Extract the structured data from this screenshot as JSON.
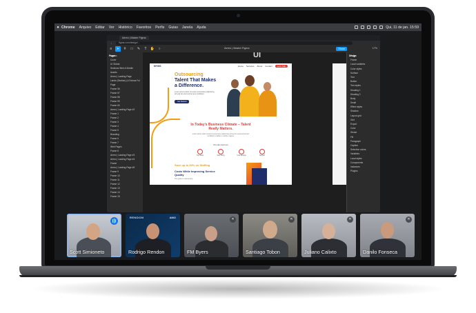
{
  "menubar": {
    "apple": "",
    "app": "Chrome",
    "items": [
      "Arquivo",
      "Editar",
      "Ver",
      "Histórico",
      "Favoritos",
      "Perfis",
      "Guias",
      "Janela",
      "Ajuda"
    ],
    "clock": "Qui, 11 de jan.  15:59"
  },
  "browser": {
    "tab": "Aereo | Master Figma",
    "url": "figma.com/design/..."
  },
  "figma": {
    "file_name": "Aereo | Master Figma",
    "share_label": "Share",
    "zoom": "17%",
    "canvas_heading": "UI",
    "layers_header": "Pages",
    "layers": [
      "Layers",
      "Cover",
      "UI Global",
      "Sections Web & Mobile",
      "Assets",
      "Aereo | Landing Page",
      "Lands (Section) (UI Novas Fol",
      "Page",
      "Frame 56",
      "Frame 57",
      "Frame 58",
      "Frame 59",
      "Frame 60",
      "Aereo | Landing Page #2",
      "Frame 1",
      "Frame 2",
      "Frame 3",
      "Frame 4",
      "Frame 5",
      "Branding",
      "Frame 6",
      "Frame 7",
      "Web Pages",
      "Frame 8",
      "Aereo | Landing Page #3",
      "Aereo | Landing Page #4",
      "Frame",
      "Aereo | Landing Page #5",
      "Frame 9",
      "Frame 10",
      "Frame 11",
      "Frame 12",
      "Frame 13",
      "Frame 14",
      "Frame 15"
    ],
    "props_header": "Design",
    "props": [
      "Page",
      "Frame",
      "Local variables",
      "Color styles",
      "Surface",
      "Text",
      "Button",
      "Text styles",
      "Heading 1",
      "Heading 2",
      "Body",
      "Small",
      "Effect styles",
      "Shadow",
      "Layout grid",
      "Grid",
      "Export",
      "Color",
      "Stroke",
      "Fill",
      "Paragraph",
      "Caption",
      "Selection colors",
      "Variables",
      "Local styles",
      "Components",
      "Instances",
      "Plugins"
    ]
  },
  "webpage": {
    "logo": "MYSIS",
    "nav_links": [
      "Home",
      "Services",
      "About",
      "Contact"
    ],
    "nav_cta": "Let's Talk",
    "hero_line1": "Outsourcing",
    "hero_line2": "Talent That Makes",
    "hero_line3": "a Difference.",
    "hero_sub": "Lorem ipsum dolor sit amet consectetur adipiscing elit sed do eiusmod tempor incididunt.",
    "hero_button": "Get Started",
    "sec2_title1": "In Today's Business Climate – Talent",
    "sec2_title2": "Really Matters.",
    "sec2_body": "Lorem ipsum dolor sit amet consectetur adipiscing elit sed do eiusmod tempor incididunt ut labore et dolore magna.",
    "sec2_heading": "You can count on:",
    "features": [
      "Top talent",
      "Fast hiring",
      "Cost savings",
      "Support"
    ],
    "sec3_line1": "Save up to 50% on Staffing",
    "sec3_line2": "Costs While Improving Service Quality",
    "sec3_sub": "The guide to outsourcing"
  },
  "meet": {
    "participants": [
      {
        "name": "Scott Simioneto",
        "speaking": true
      },
      {
        "name": "Rodrigo Rendon",
        "speaking": false
      },
      {
        "name": "FM Byers",
        "speaking": false
      },
      {
        "name": "Santiago Tobon",
        "speaking": false
      },
      {
        "name": "Juliano Calixto",
        "speaking": false
      },
      {
        "name": "Danilo Fonseca",
        "speaking": false
      }
    ],
    "brand_left": "RENDON",
    "brand_right": "AMO"
  },
  "colors": {
    "accent_blue": "#1a73e8",
    "brand_orange": "#f39c12",
    "brand_navy": "#1f2d6b",
    "brand_red": "#e53935",
    "figma_blue": "#0d99ff"
  }
}
